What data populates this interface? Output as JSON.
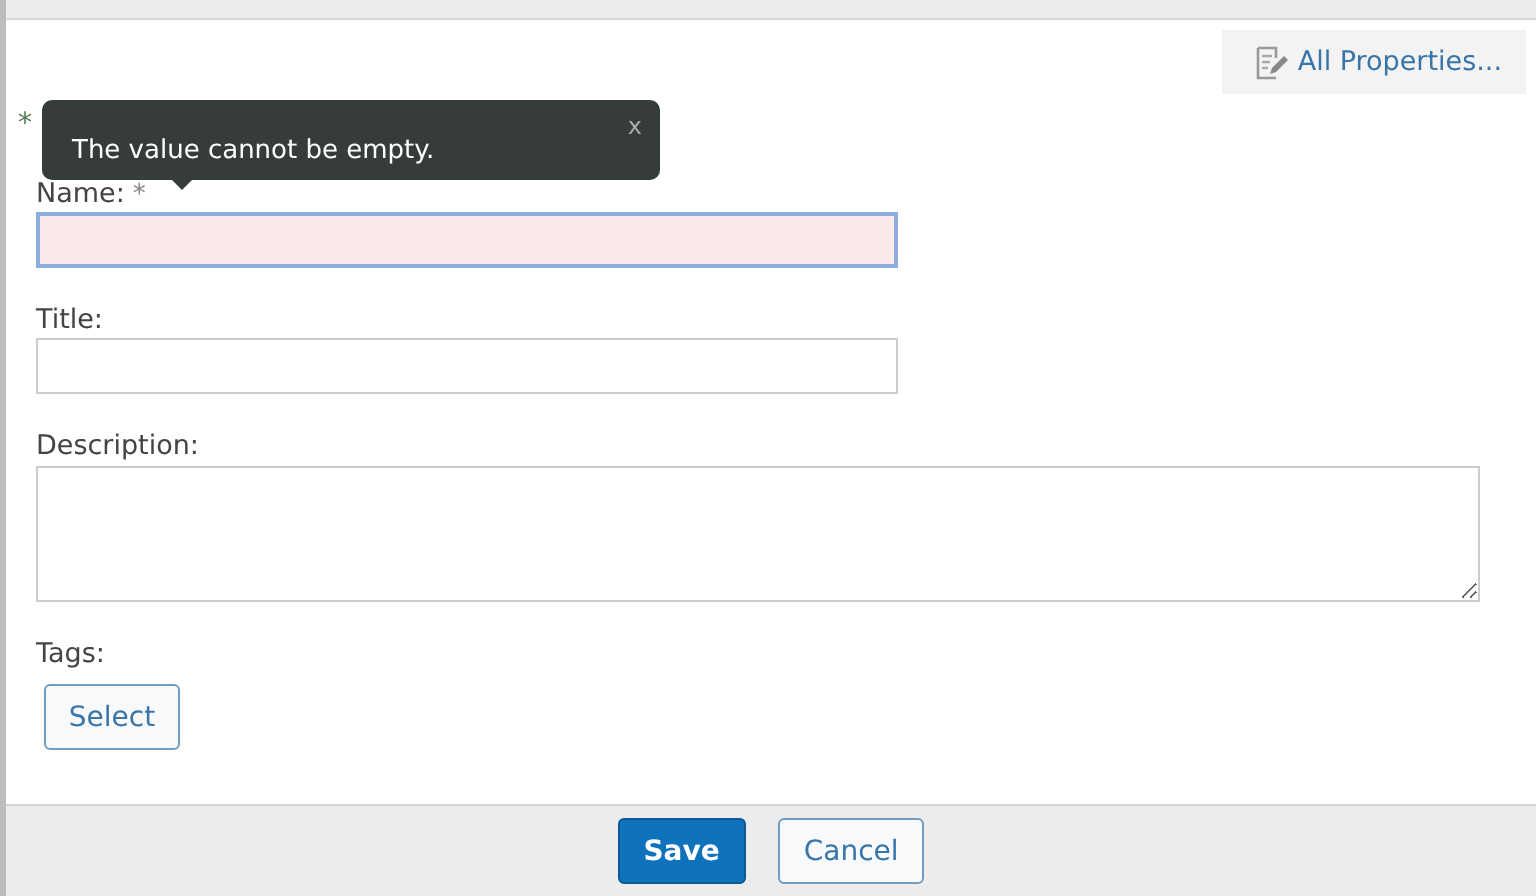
{
  "toolbar": {
    "all_properties_link": "All Properties..."
  },
  "required_note": "*",
  "fields": [
    {
      "kind": "input",
      "label": "Name:",
      "required_mark": "*",
      "invalid": true
    },
    {
      "kind": "input",
      "label": "Title:",
      "invalid": false
    },
    {
      "kind": "textarea",
      "label": "Description:",
      "invalid": false
    },
    {
      "kind": "picker",
      "label": "Tags:",
      "button": "Select"
    }
  ],
  "tooltip": {
    "message": "The value cannot be empty.",
    "close": "x"
  },
  "buttons": [
    {
      "label": "Save",
      "primary": true
    },
    {
      "label": "Cancel",
      "primary": false
    }
  ]
}
